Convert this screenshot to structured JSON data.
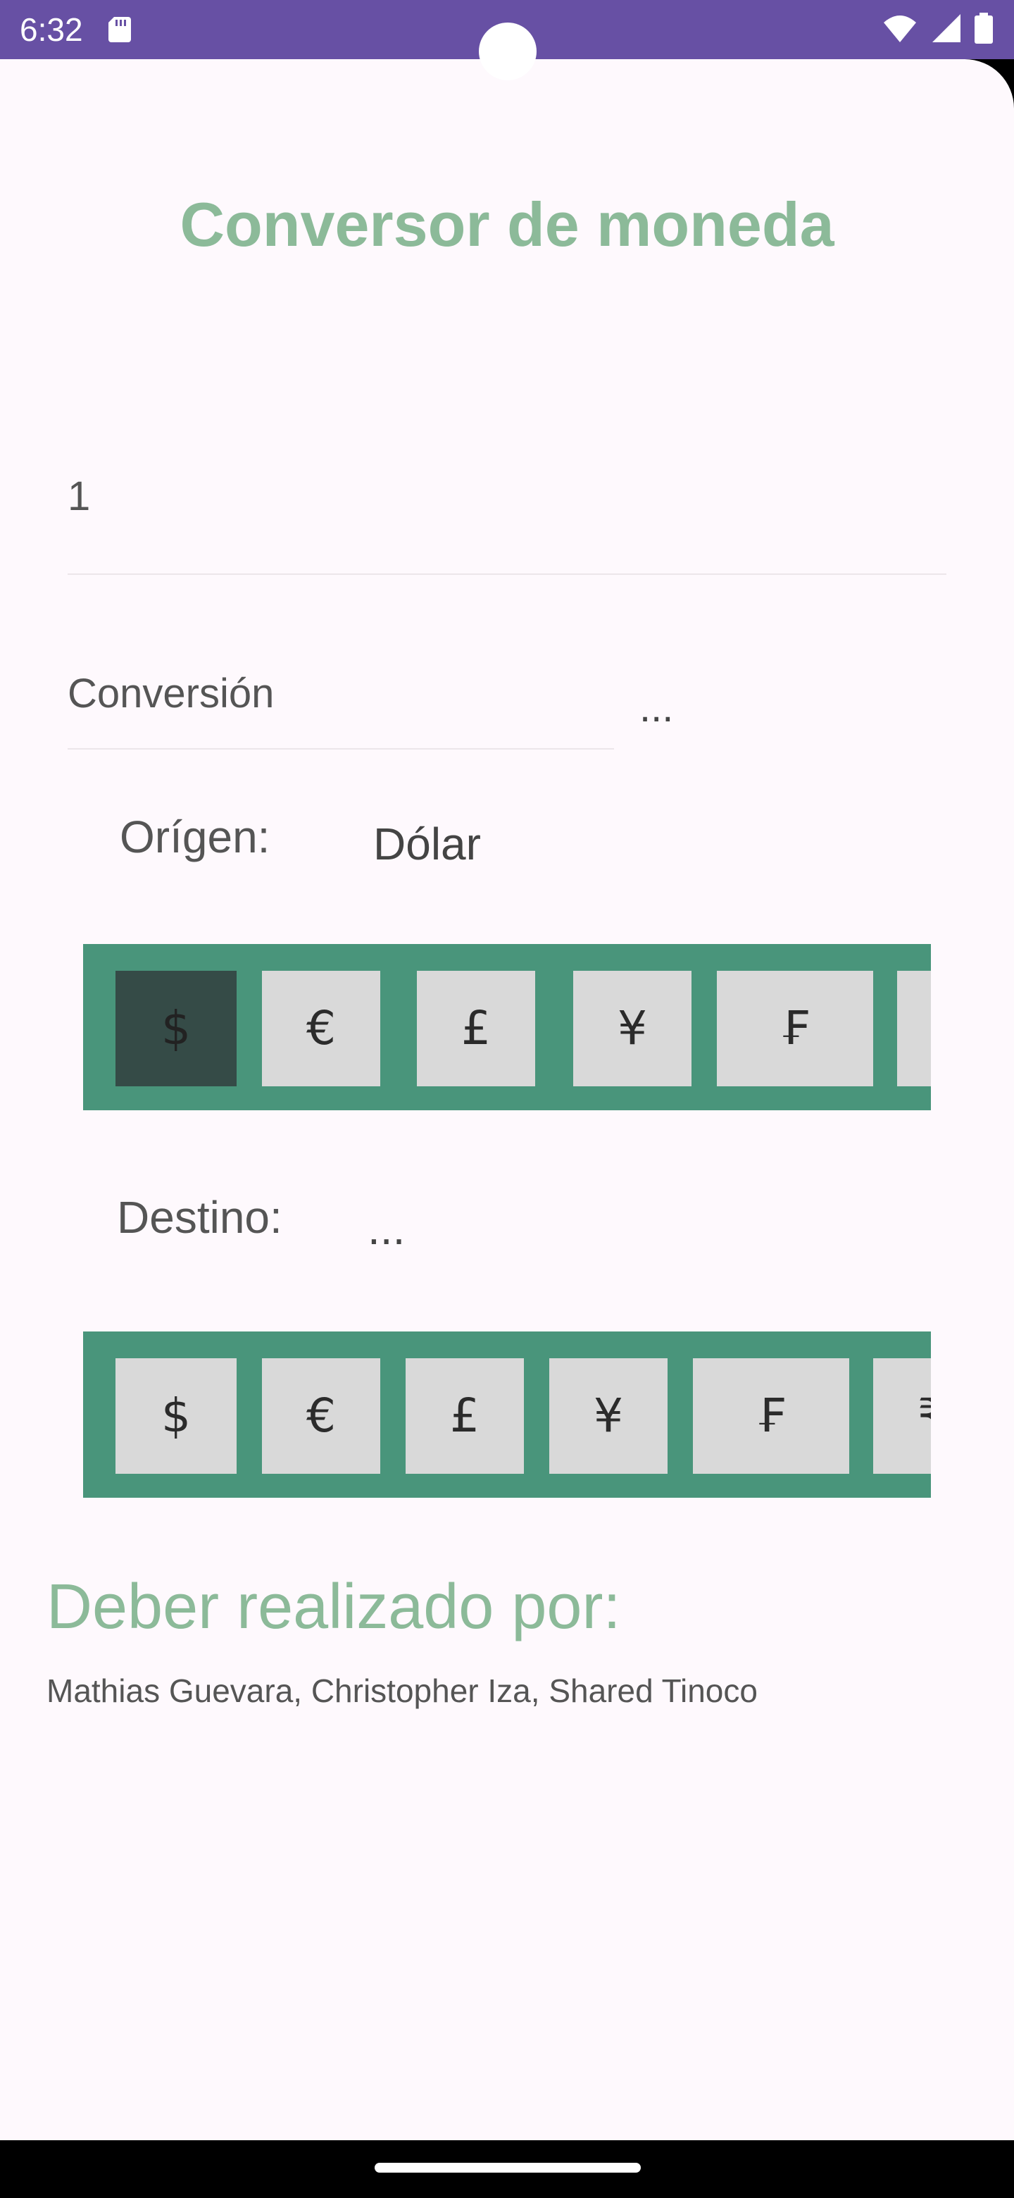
{
  "status_bar": {
    "time": "6:32",
    "icons": [
      "sd-card-icon",
      "wifi-icon",
      "cellular-signal-icon",
      "battery-icon"
    ],
    "background": "#6750A4"
  },
  "app": {
    "title": "Conversor de moneda",
    "title_color": "#8CBA99",
    "amount_input": {
      "value": "1"
    },
    "conversion_field": {
      "label": "Conversión",
      "result": "..."
    },
    "origin": {
      "label": "Orígen:",
      "selected_value": "Dólar",
      "currencies": [
        "$",
        "€",
        "£",
        "¥",
        "₣",
        "₹"
      ],
      "selected_index": 0
    },
    "destination": {
      "label": "Destino:",
      "selected_value": "...",
      "currencies": [
        "$",
        "€",
        "£",
        "¥",
        "₣",
        "₹"
      ]
    },
    "strip_color": "#49957B",
    "credits": {
      "heading": "Deber realizado por:",
      "names": "Mathias Guevara, Christopher Iza, Shared Tinoco"
    }
  }
}
